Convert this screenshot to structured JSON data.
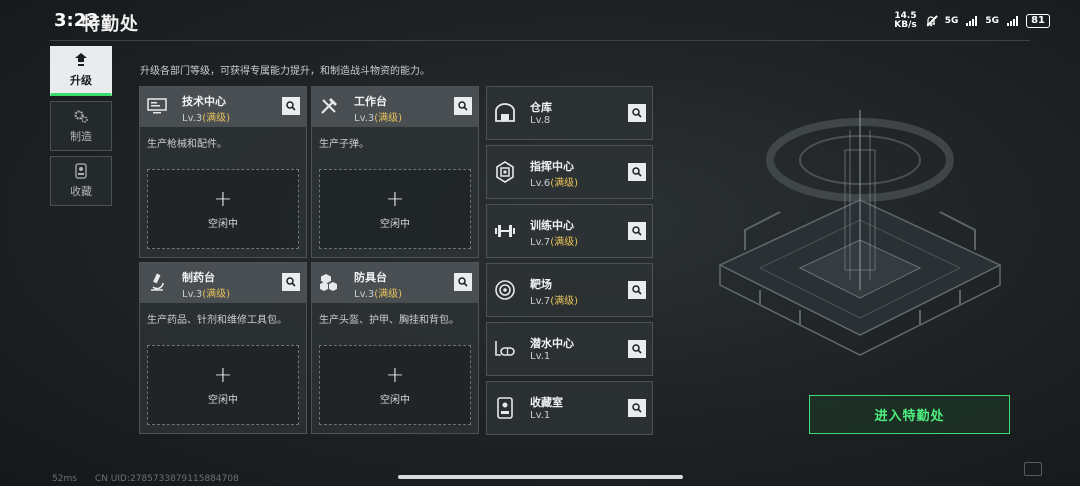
{
  "status_bar": {
    "time": "3:22",
    "net_speed_value": "14.5",
    "net_speed_unit": "KB/s",
    "sim1": "5G",
    "sim2": "5G",
    "battery": "81"
  },
  "page_title": "特勤处",
  "left_nav": [
    {
      "label": "升级",
      "icon": "upgrade-icon",
      "active": true
    },
    {
      "label": "制造",
      "icon": "gears-icon",
      "active": false
    },
    {
      "label": "收藏",
      "icon": "collection-icon",
      "active": false
    }
  ],
  "description": "升级各部门等级，可获得专属能力提升，和制造战斗物资的能力。",
  "modules": [
    {
      "name": "技术中心",
      "level": "Lv.3",
      "max": "(满级)",
      "desc": "生产枪械和配件。",
      "slot": "空闲中",
      "icon": "monitor-icon"
    },
    {
      "name": "工作台",
      "level": "Lv.3",
      "max": "(满级)",
      "desc": "生产子弹。",
      "slot": "空闲中",
      "icon": "tools-icon"
    },
    {
      "name": "制药台",
      "level": "Lv.3",
      "max": "(满级)",
      "desc": "生产药品、针剂和维修工具包。",
      "slot": "空闲中",
      "icon": "microscope-icon"
    },
    {
      "name": "防具台",
      "level": "Lv.3",
      "max": "(满级)",
      "desc": "生产头盔、护甲、胸挂和背包。",
      "slot": "空闲中",
      "icon": "armor-boxes-icon"
    }
  ],
  "facilities": [
    {
      "name": "仓库",
      "level": "Lv.8",
      "max": "",
      "icon": "warehouse-icon"
    },
    {
      "name": "指挥中心",
      "level": "Lv.6",
      "max": "(满级)",
      "icon": "chip-icon"
    },
    {
      "name": "训练中心",
      "level": "Lv.7",
      "max": "(满级)",
      "icon": "dumbbell-icon"
    },
    {
      "name": "靶场",
      "level": "Lv.7",
      "max": "(满级)",
      "icon": "target-icon"
    },
    {
      "name": "潜水中心",
      "level": "Lv.1",
      "max": "",
      "icon": "diving-mask-icon"
    },
    {
      "name": "收藏室",
      "level": "Lv.1",
      "max": "",
      "icon": "collection-room-icon"
    }
  ],
  "enter_button": "进入特勤处",
  "footer": {
    "ping": "52ms",
    "uid": "CN UID:2785733879115884708"
  },
  "colors": {
    "accent_green": "#3ddc6e",
    "max_level_gold": "#e8c25a",
    "background": "#1e2224"
  }
}
